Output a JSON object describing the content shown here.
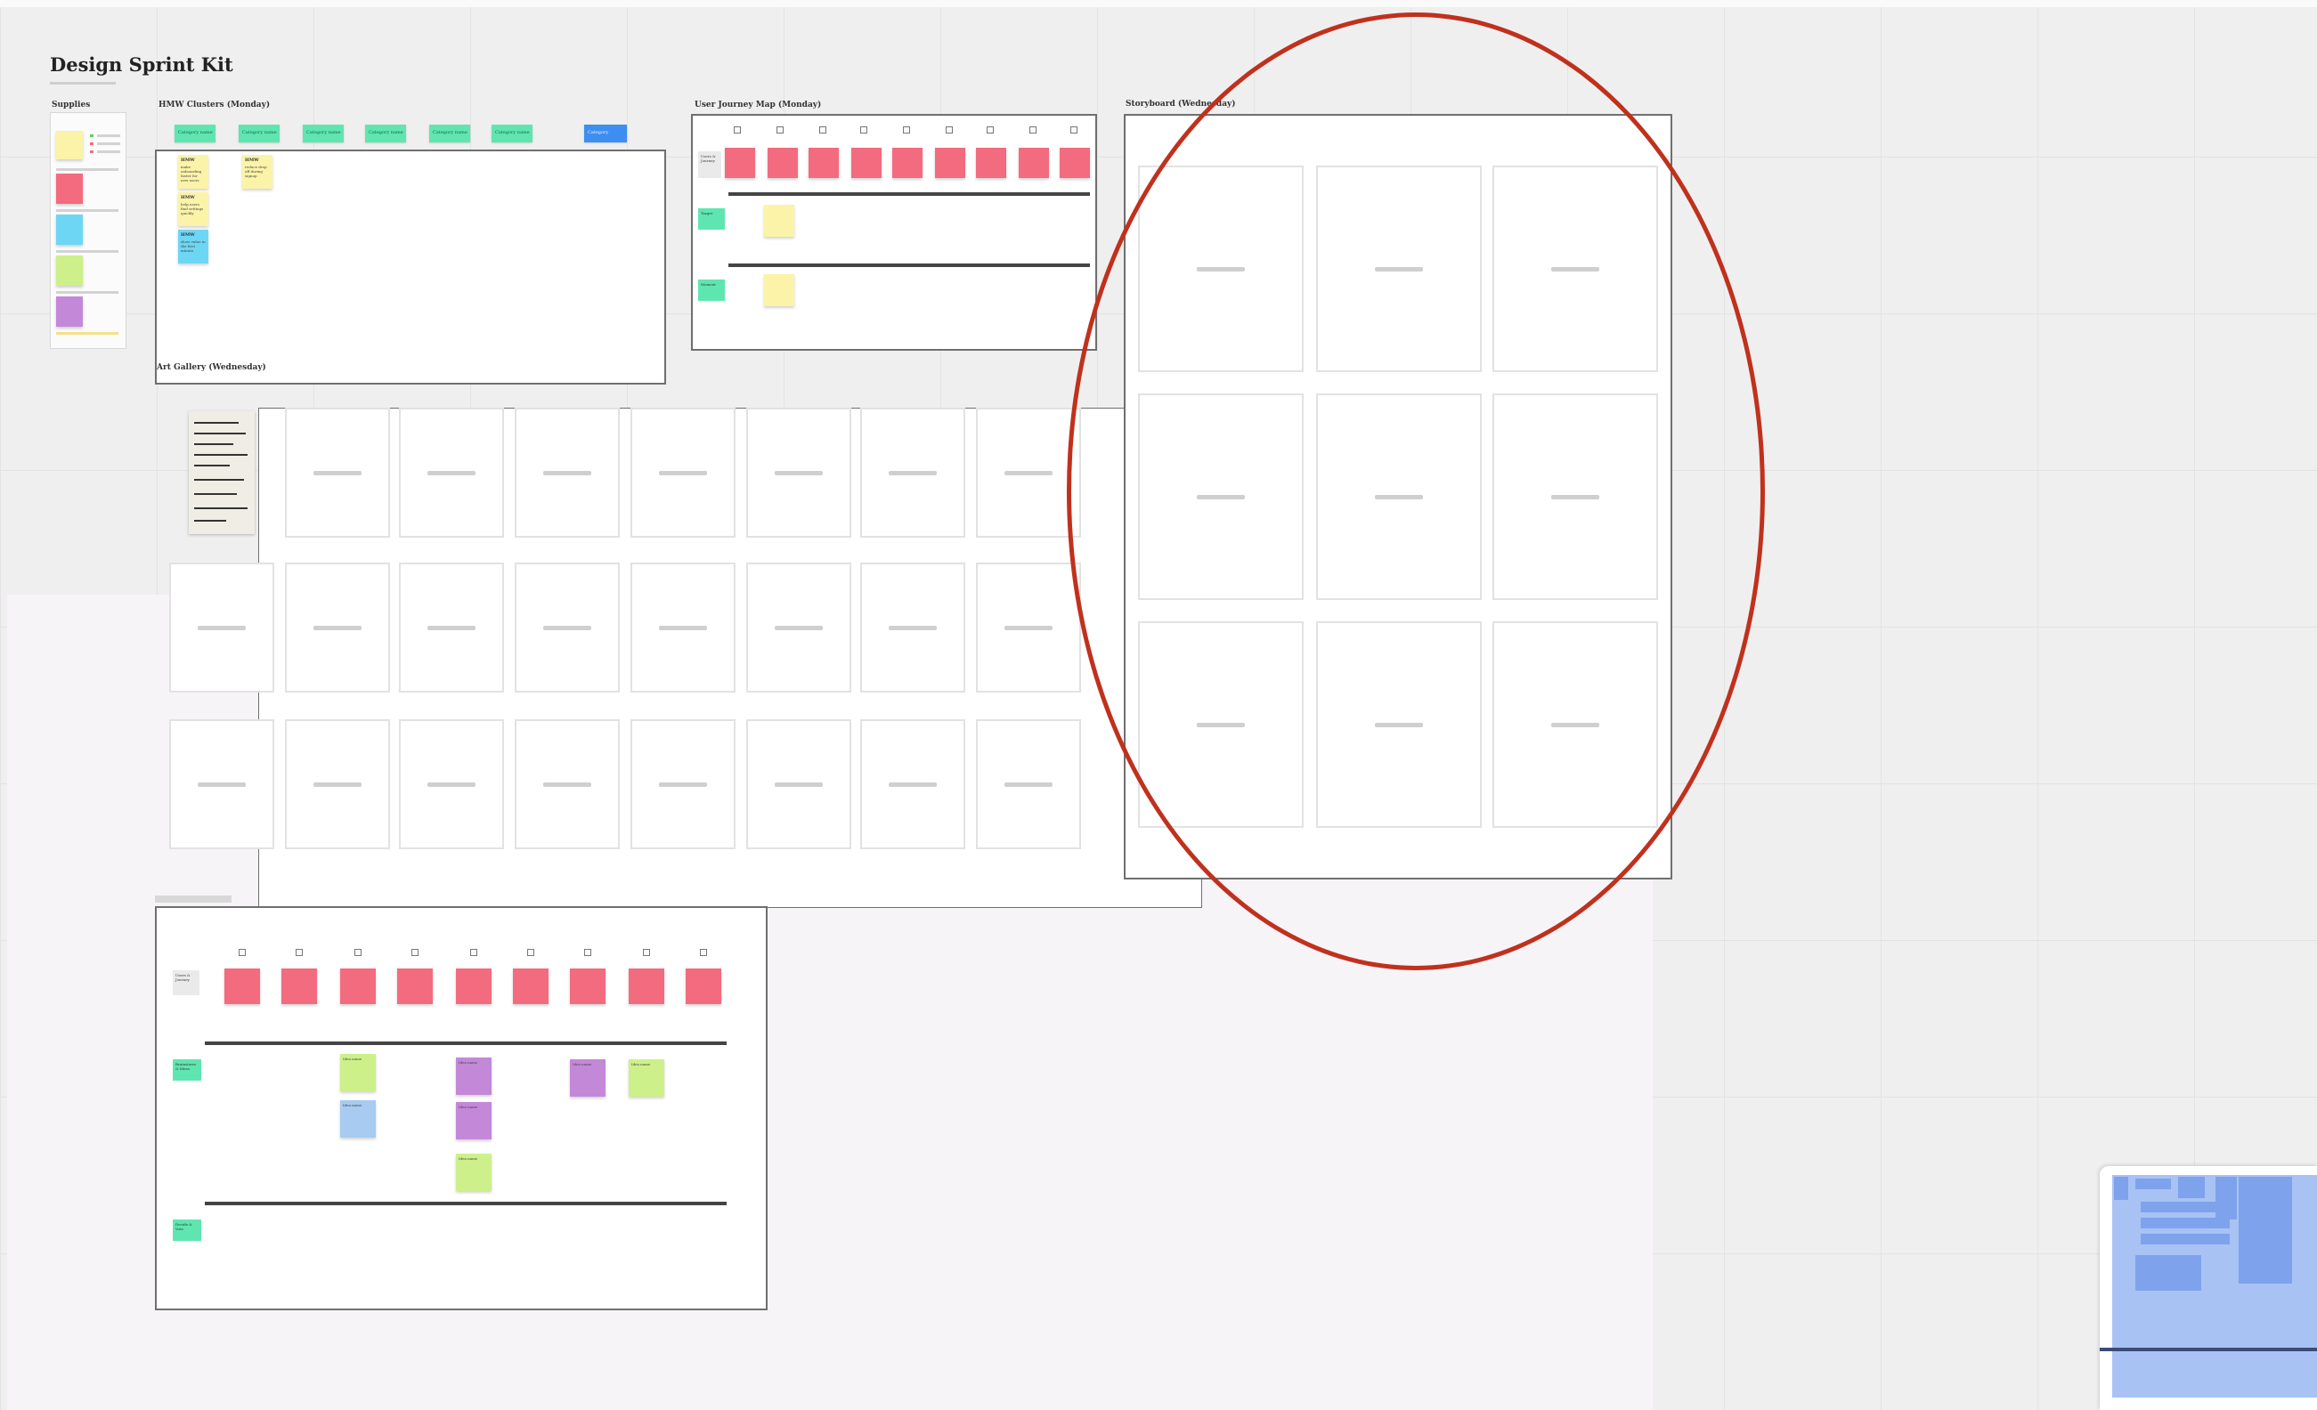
{
  "board": {
    "title": "Design Sprint Kit"
  },
  "supplies": {
    "label": "Supplies"
  },
  "hmw": {
    "label": "HMW Clusters (Monday)",
    "tags": [
      "Category name",
      "Category name",
      "Category name",
      "Category name",
      "Category name",
      "Category name"
    ],
    "blue_tag": "Category",
    "stickies": [
      {
        "title": "HMW",
        "body": "make onboarding faster for new users"
      },
      {
        "title": "HMW",
        "body": "reduce drop off during signup"
      },
      {
        "title": "HMW",
        "body": "help users find settings quickly"
      },
      {
        "title": "HMW",
        "body": "show value in the first minute"
      }
    ]
  },
  "journey_top": {
    "label": "User Journey Map (Monday)",
    "row_labels": [
      "Users & Journey",
      "Target",
      "Moment"
    ]
  },
  "art_gallery": {
    "label": "Art Gallery (Wednesday)"
  },
  "storyboard": {
    "label": "Storyboard (Wednesday)"
  },
  "journey_bottom": {
    "row_labels": [
      "Users & Journey",
      "Brainstorm & Ideas",
      "Decide & Vote"
    ],
    "ideas": [
      "Idea name",
      "Idea name",
      "Idea name",
      "Idea name",
      "Idea name",
      "Idea name",
      "Idea name",
      "Idea name"
    ]
  },
  "colors": {
    "yellow": "#fbf3a8",
    "pink": "#f36b7f",
    "cyan": "#6ed6f5",
    "green": "#cdf08a",
    "purple": "#c488d8",
    "teal": "#5fe6b0",
    "blue": "#3c8ef0",
    "lightblue": "#a7cbf1",
    "annotation": "#c0311d"
  }
}
